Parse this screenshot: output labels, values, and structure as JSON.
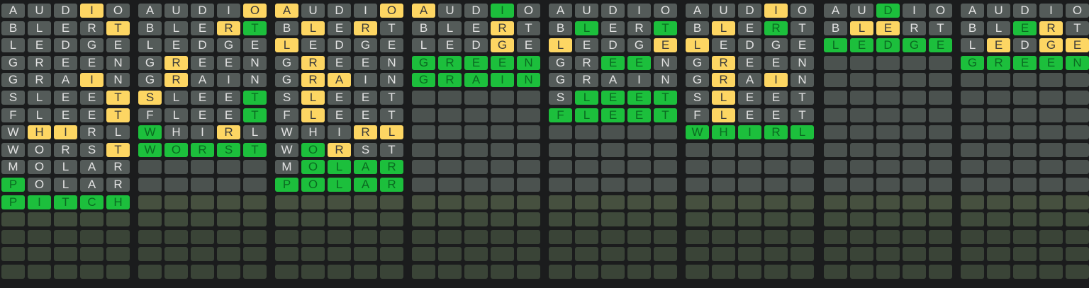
{
  "colors": {
    "background": "#1b1c1d",
    "absent": "#545b59",
    "present": "#fdd663",
    "correct": "#1cbf3c",
    "empty": "#4b524f"
  },
  "rows_per_board": 16,
  "letters_per_row": 5,
  "boards": [
    {
      "rows": [
        {
          "word": "AUDIO",
          "states": "xxxyx"
        },
        {
          "word": "BLERT",
          "states": "xxxxy"
        },
        {
          "word": "LEDGE",
          "states": "xxxxx"
        },
        {
          "word": "GREEN",
          "states": "xxxxx"
        },
        {
          "word": "GRAIN",
          "states": "xxxyx"
        },
        {
          "word": "SLEET",
          "states": "xxxxy"
        },
        {
          "word": "FLEET",
          "states": "xxxxy"
        },
        {
          "word": "WHIRL",
          "states": "xyyxx"
        },
        {
          "word": "WORST",
          "states": "xxxxy"
        },
        {
          "word": "MOLAR",
          "states": "xxxxx"
        },
        {
          "word": "POLAR",
          "states": "gxxxx"
        },
        {
          "word": "PITCH",
          "states": "ggggg"
        }
      ]
    },
    {
      "rows": [
        {
          "word": "AUDIO",
          "states": "xxxxy"
        },
        {
          "word": "BLERT",
          "states": "xxxyg"
        },
        {
          "word": "LEDGE",
          "states": "xxxxx"
        },
        {
          "word": "GREEN",
          "states": "xyxxx"
        },
        {
          "word": "GRAIN",
          "states": "xyxxx"
        },
        {
          "word": "SLEET",
          "states": "yxxxg"
        },
        {
          "word": "FLEET",
          "states": "xxxxg"
        },
        {
          "word": "WHIRL",
          "states": "gxxyx"
        },
        {
          "word": "WORST",
          "states": "ggggg"
        }
      ]
    },
    {
      "rows": [
        {
          "word": "AUDIO",
          "states": "yxxxy"
        },
        {
          "word": "BLERT",
          "states": "xyxyx"
        },
        {
          "word": "LEDGE",
          "states": "yxxxx"
        },
        {
          "word": "GREEN",
          "states": "xyxxx"
        },
        {
          "word": "GRAIN",
          "states": "xyyxx"
        },
        {
          "word": "SLEET",
          "states": "xyxxx"
        },
        {
          "word": "FLEET",
          "states": "xyxxx"
        },
        {
          "word": "WHIRL",
          "states": "xxxyy"
        },
        {
          "word": "WORST",
          "states": "xgyxx"
        },
        {
          "word": "MOLAR",
          "states": "xgggg"
        },
        {
          "word": "POLAR",
          "states": "ggggg"
        }
      ]
    },
    {
      "rows": [
        {
          "word": "AUDIO",
          "states": "yxxgx"
        },
        {
          "word": "BLERT",
          "states": "xxxyx"
        },
        {
          "word": "LEDGE",
          "states": "xxxyx"
        },
        {
          "word": "GREEN",
          "states": "ggggg"
        },
        {
          "word": "GRAIN",
          "states": "ggggg"
        }
      ]
    },
    {
      "rows": [
        {
          "word": "AUDIO",
          "states": "xxxxx"
        },
        {
          "word": "BLERT",
          "states": "xgxxg"
        },
        {
          "word": "LEDGE",
          "states": "yxxxy"
        },
        {
          "word": "GREEN",
          "states": "xxggx"
        },
        {
          "word": "GRAIN",
          "states": "xxxxx"
        },
        {
          "word": "SLEET",
          "states": "xgggg"
        },
        {
          "word": "FLEET",
          "states": "ggggg"
        }
      ]
    },
    {
      "rows": [
        {
          "word": "AUDIO",
          "states": "xxxyx"
        },
        {
          "word": "BLERT",
          "states": "xyxgx"
        },
        {
          "word": "LEDGE",
          "states": "yxxxx"
        },
        {
          "word": "GREEN",
          "states": "xyxxx"
        },
        {
          "word": "GRAIN",
          "states": "xyxyx"
        },
        {
          "word": "SLEET",
          "states": "xyxxx"
        },
        {
          "word": "FLEET",
          "states": "xyxxx"
        },
        {
          "word": "WHIRL",
          "states": "ggggg"
        }
      ]
    },
    {
      "rows": [
        {
          "word": "AUDIO",
          "states": "xxgxx"
        },
        {
          "word": "BLERT",
          "states": "xyyxx"
        },
        {
          "word": "LEDGE",
          "states": "ggggg"
        }
      ]
    },
    {
      "rows": [
        {
          "word": "AUDIO",
          "states": "xxxxx"
        },
        {
          "word": "BLERT",
          "states": "xxgyx"
        },
        {
          "word": "LEDGE",
          "states": "xyxyy"
        },
        {
          "word": "GREEN",
          "states": "ggggg"
        }
      ]
    }
  ]
}
